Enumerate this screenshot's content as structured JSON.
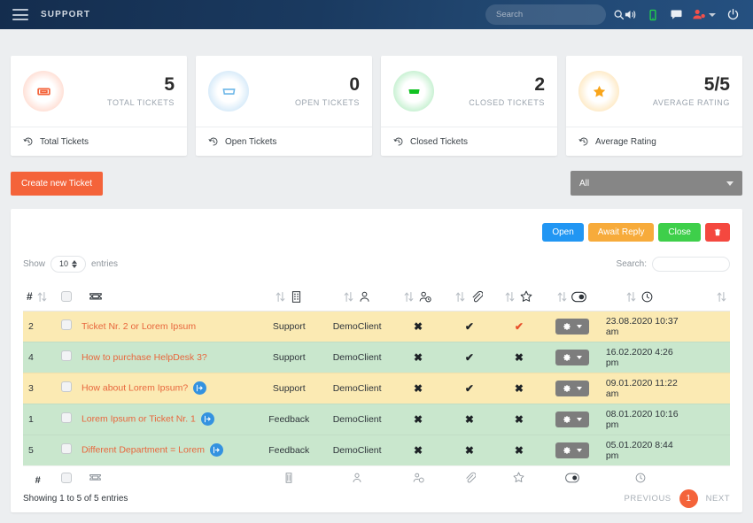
{
  "header": {
    "brand": "SUPPORT",
    "menu_icon": "hamburger-icon",
    "search_placeholder": "Search",
    "search_value": "",
    "icons": [
      "volume-icon",
      "mobile-icon",
      "chat-icon",
      "user-icon",
      "power-icon"
    ]
  },
  "cards": [
    {
      "icon": "ticket-icon",
      "value": "5",
      "label": "TOTAL TICKETS",
      "foot": "Total Tickets",
      "color": "#f4633a",
      "glow": "glow-red"
    },
    {
      "icon": "ticket-icon",
      "value": "0",
      "label": "OPEN TICKETS",
      "foot": "Open Tickets",
      "color": "#6cb6e8",
      "glow": "glow-blue"
    },
    {
      "icon": "ticket-icon",
      "value": "2",
      "label": "CLOSED TICKETS",
      "foot": "Closed Tickets",
      "color": "#12c223",
      "glow": "glow-green"
    },
    {
      "icon": "star-icon",
      "value": "5/5",
      "label": "AVERAGE RATING",
      "foot": "Average Rating",
      "color": "#f9a51a",
      "glow": "glow-amber"
    }
  ],
  "actions": {
    "create_label": "Create new Ticket",
    "filter_value": "All"
  },
  "status_buttons": [
    {
      "label": "Open",
      "color": "#2196f3"
    },
    {
      "label": "Await Reply",
      "color": "#f7ab3b"
    },
    {
      "label": "Close",
      "color": "#3ecf4a"
    }
  ],
  "delete_button": {
    "icon": "trash-icon",
    "color": "#f4483f"
  },
  "table_controls": {
    "show_label": "Show",
    "entries_value": "10",
    "entries_label": "entries",
    "search_label": "Search:",
    "search_value": ""
  },
  "table": {
    "columns": [
      {
        "key": "num",
        "icon": "hash",
        "sort": true
      },
      {
        "key": "check",
        "icon": "checkbox-icon",
        "sort": false
      },
      {
        "key": "ticket",
        "icon": "ticket-icon",
        "sort": false
      },
      {
        "key": "dept",
        "icon": "building-icon",
        "sort": true
      },
      {
        "key": "client",
        "icon": "person-icon",
        "sort": true
      },
      {
        "key": "agent",
        "icon": "user-clock-icon",
        "sort": true
      },
      {
        "key": "attach",
        "icon": "paperclip-icon",
        "sort": true
      },
      {
        "key": "star",
        "icon": "star-outline-icon",
        "sort": true
      },
      {
        "key": "toggle",
        "icon": "toggle-icon",
        "sort": true
      },
      {
        "key": "date",
        "icon": "clock-icon",
        "sort": true
      },
      {
        "key": "end",
        "icon": "",
        "sort": true
      }
    ],
    "rows": [
      {
        "num": "2",
        "title": "Ticket Nr. 2 or Lorem Ipsum",
        "badge": false,
        "dept": "Support",
        "client": "DemoClient",
        "m1": "x",
        "m2": "check",
        "m3": "check-red",
        "date": "23.08.2020 10:37 am",
        "tint": "row-yellow"
      },
      {
        "num": "4",
        "title": "How to purchase HelpDesk 3?",
        "badge": false,
        "dept": "Support",
        "client": "DemoClient",
        "m1": "x",
        "m2": "check",
        "m3": "x",
        "date": "16.02.2020 4:26 pm",
        "tint": "row-green"
      },
      {
        "num": "3",
        "title": "How about Lorem Ipsum?",
        "badge": true,
        "dept": "Support",
        "client": "DemoClient",
        "m1": "x",
        "m2": "check",
        "m3": "x",
        "date": "09.01.2020 11:22 am",
        "tint": "row-yellow"
      },
      {
        "num": "1",
        "title": "Lorem Ipsum or Ticket Nr. 1",
        "badge": true,
        "dept": "Feedback",
        "client": "DemoClient",
        "m1": "x",
        "m2": "x",
        "m3": "x",
        "date": "08.01.2020 10:16 pm",
        "tint": "row-green"
      },
      {
        "num": "5",
        "title": "Different Department = Lorem",
        "badge": true,
        "dept": "Feedback",
        "client": "DemoClient",
        "m1": "x",
        "m2": "x",
        "m3": "x",
        "date": "05.01.2020 8:44 pm",
        "tint": "row-green"
      }
    ],
    "row_action": {
      "icon": "gear-icon",
      "caret": "caret-down-icon"
    },
    "footer_hash": "#"
  },
  "pagination": {
    "showing": "Showing 1 to 5 of 5 entries",
    "previous": "PREVIOUS",
    "current": "1",
    "next": "NEXT"
  }
}
